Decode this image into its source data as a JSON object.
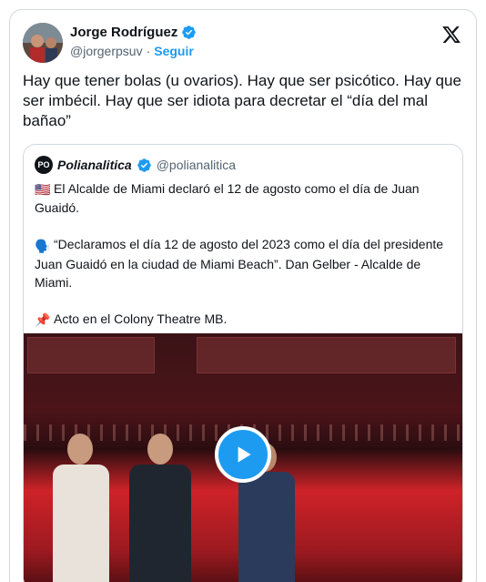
{
  "author": {
    "name": "Jorge Rodríguez",
    "handle": "@jorgerpsuv",
    "separator": "·",
    "follow_label": "Seguir"
  },
  "tweet": {
    "text": "Hay que tener bolas (u ovarios). Hay que ser psicótico. Hay que ser imbécil. Hay que ser idiota para decretar el “día del mal bañao”"
  },
  "quoted": {
    "avatar_text": "PO",
    "name": "Polianalitica",
    "handle": "@polianalitica",
    "paragraphs": [
      {
        "emoji": "🇺🇸",
        "emoji_name": "us-flag-icon",
        "text": "El Alcalde de Miami declaró el 12 de agosto como el día de Juan Guaidó."
      },
      {
        "emoji": "🗣️",
        "emoji_name": "speaking-head-icon",
        "text": "“Declaramos el día 12 de agosto del 2023 como el día del presidente Juan Guaidó en la ciudad de Miami Beach”. Dan Gelber - Alcalde de Miami."
      },
      {
        "emoji": "📌",
        "emoji_name": "pushpin-icon",
        "text": "Acto en el Colony Theatre MB."
      }
    ]
  },
  "icons": {
    "verified": "verified-badge-icon",
    "x_logo": "x-logo-icon",
    "play": "play-icon"
  },
  "colors": {
    "accent": "#1d9bf0",
    "text": "#0f1419",
    "muted": "#536471",
    "border": "#cfd9de"
  }
}
